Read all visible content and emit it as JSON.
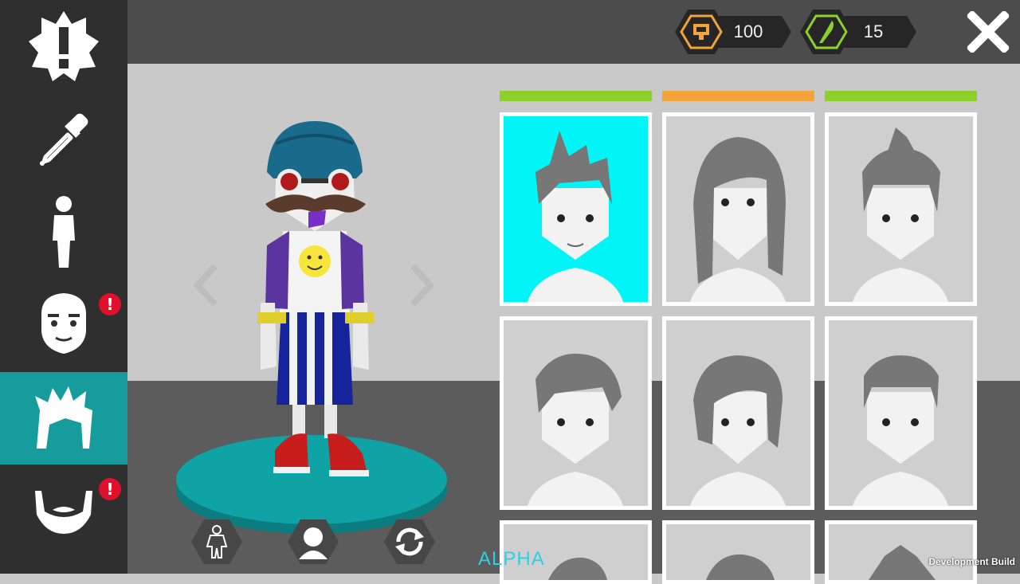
{
  "currencies": [
    {
      "name": "coins",
      "value": "100",
      "icon": "coin-icon",
      "color": "#f2a33a"
    },
    {
      "name": "gems",
      "value": "15",
      "icon": "feather-gem-icon",
      "color": "#8cd12a"
    }
  ],
  "sidebar": {
    "items": [
      {
        "name": "alerts",
        "icon": "exclamation-badge-icon"
      },
      {
        "name": "color-picker",
        "icon": "eyedropper-icon"
      },
      {
        "name": "body",
        "icon": "body-icon"
      },
      {
        "name": "face",
        "icon": "face-icon",
        "alert": "!"
      },
      {
        "name": "hair",
        "icon": "hair-icon",
        "active": true
      },
      {
        "name": "beard",
        "icon": "beard-icon",
        "alert": "!"
      }
    ],
    "active_color": "#169c9c"
  },
  "hair_grid": {
    "header_colors": [
      "#8cd12a",
      "#f2a33a",
      "#8cd12a"
    ],
    "selected_color": "#00f6f6",
    "items": [
      {
        "style": "spiky",
        "selected": true
      },
      {
        "style": "long"
      },
      {
        "style": "topknot"
      },
      {
        "style": "short-swept"
      },
      {
        "style": "bob"
      },
      {
        "style": "buzz"
      }
    ]
  },
  "overlay": {
    "alpha_label": "ALPHA",
    "dev_build_label": "Development Build"
  },
  "colors": {
    "platform": "#0fa3a6",
    "sidebar_bg": "#2f2f2f",
    "topbar_bg": "#4c4c4c"
  }
}
